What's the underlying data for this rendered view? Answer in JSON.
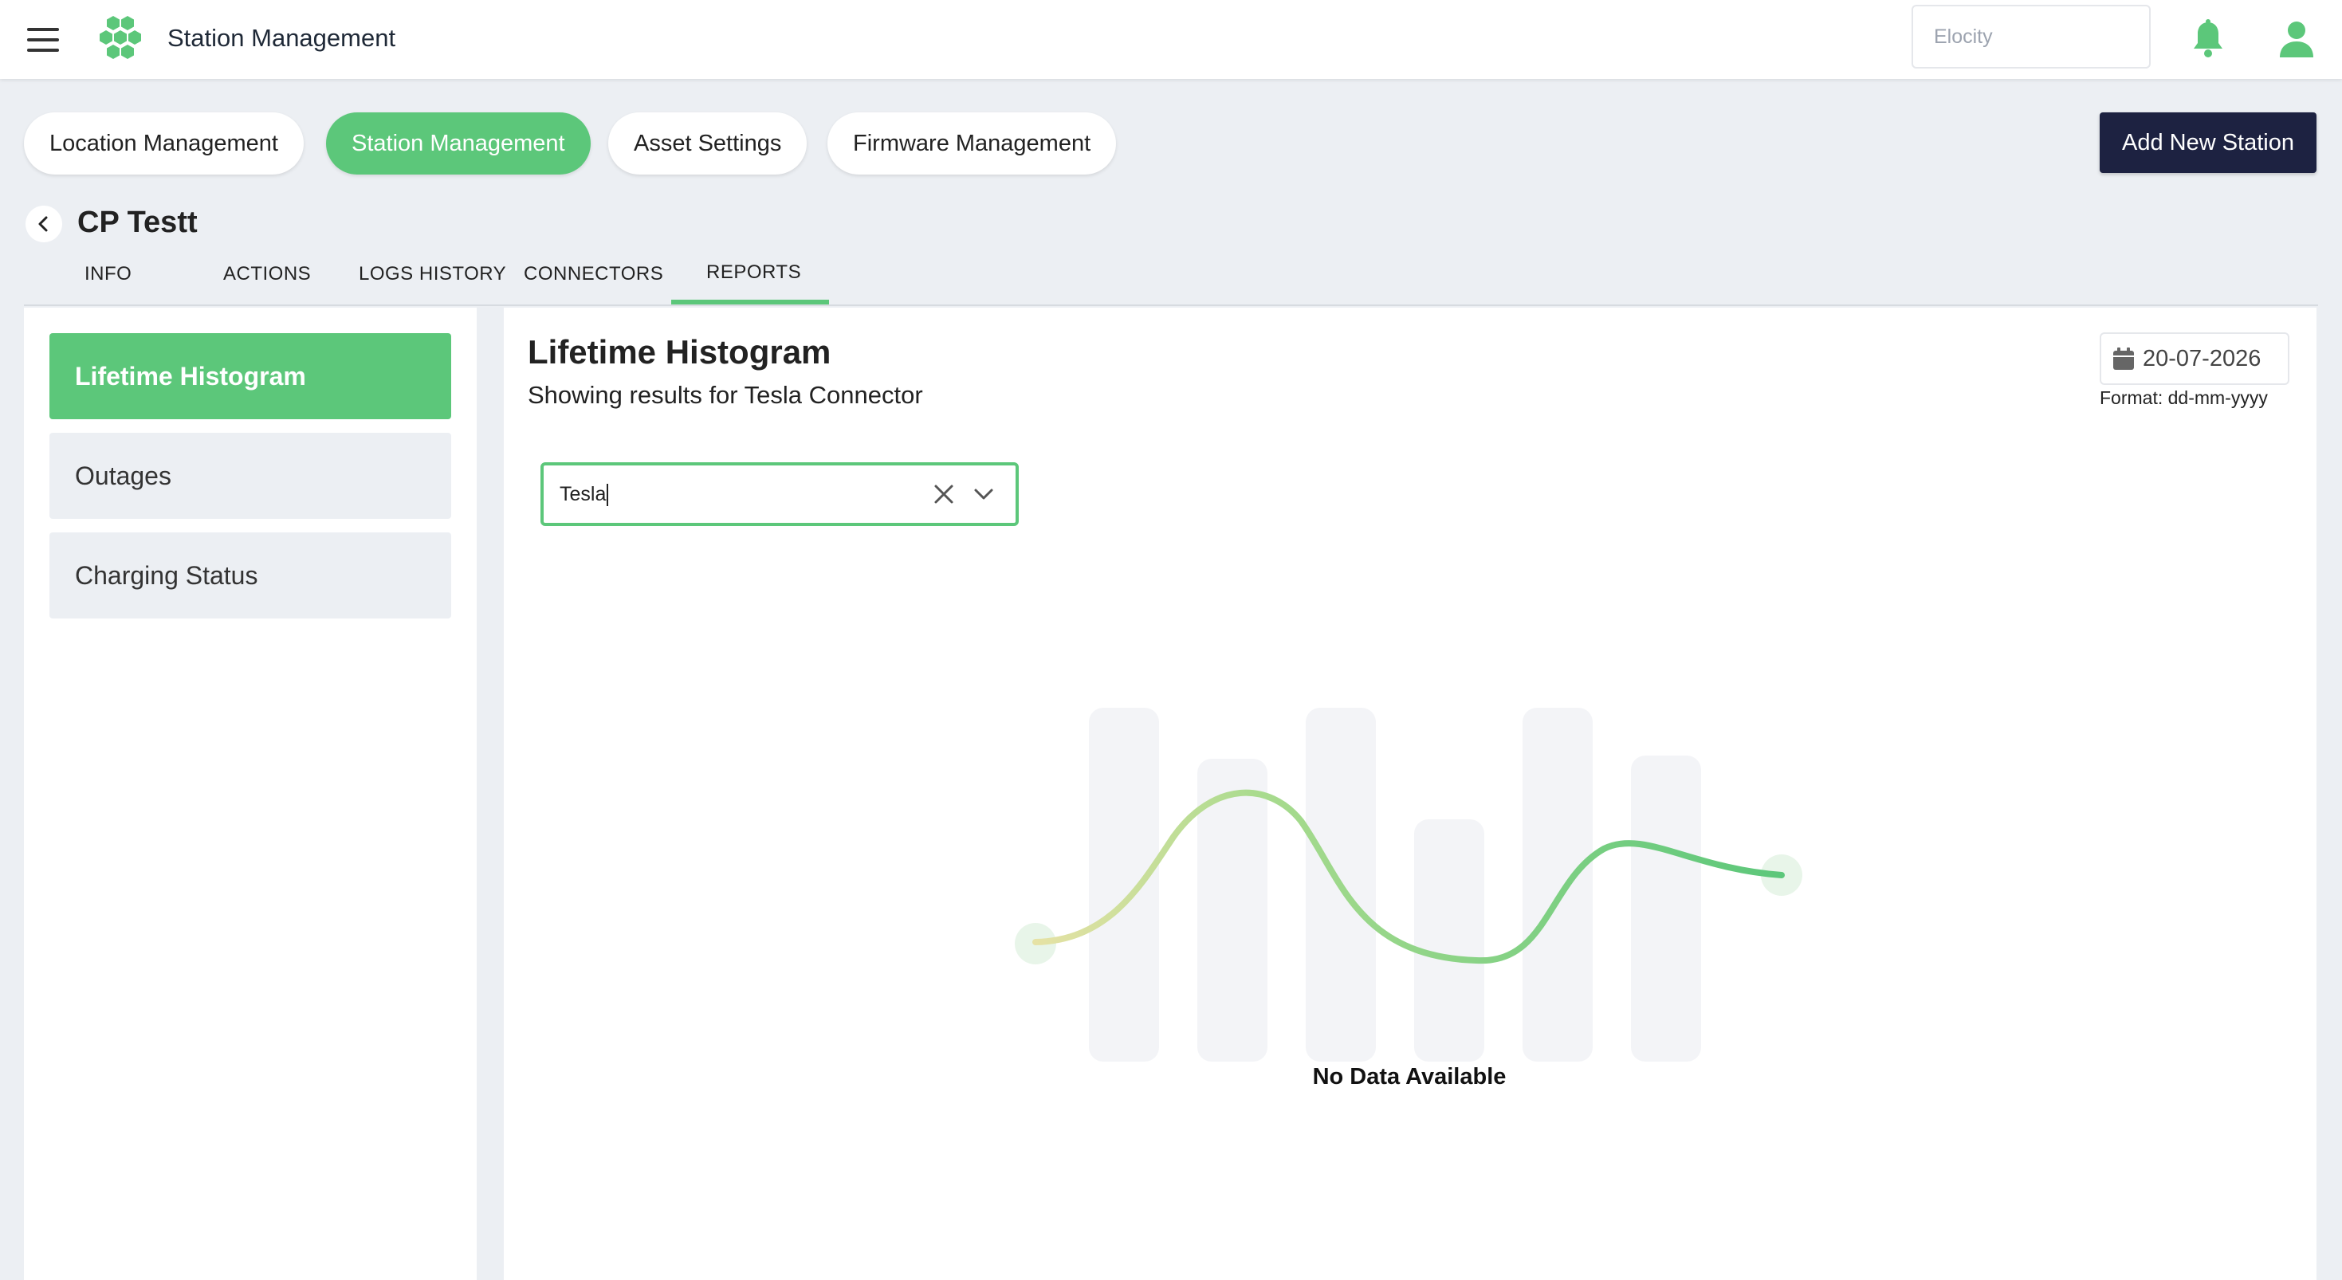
{
  "header": {
    "app_title": "Station Management",
    "org_select": {
      "value": "Elocity"
    },
    "icons": [
      "menu-icon",
      "logo-icon",
      "bell-icon",
      "user-icon"
    ],
    "accent_color": "#5cc77a"
  },
  "top_tabs": [
    {
      "label": "Location Management",
      "active": false
    },
    {
      "label": "Station Management",
      "active": true
    },
    {
      "label": "Asset Settings",
      "active": false
    },
    {
      "label": "Firmware Management",
      "active": false
    }
  ],
  "add_button": {
    "label": "Add New Station",
    "color": "#1d2241"
  },
  "station": {
    "title": "CP Testt",
    "tabs": [
      {
        "label": "INFO",
        "active": false
      },
      {
        "label": "ACTIONS",
        "active": false
      },
      {
        "label": "LOGS HISTORY",
        "active": false
      },
      {
        "label": "CONNECTORS",
        "active": false
      },
      {
        "label": "REPORTS",
        "active": true
      }
    ]
  },
  "sidebar": {
    "items": [
      {
        "label": "Lifetime Histogram",
        "active": true
      },
      {
        "label": "Outages",
        "active": false
      },
      {
        "label": "Charging Status",
        "active": false
      }
    ]
  },
  "report": {
    "title": "Lifetime Histogram",
    "subtitle": "Showing results for Tesla Connector",
    "date": {
      "value": "20-07-2026",
      "format_hint": "Format: dd-mm-yyyy"
    },
    "connector_select": {
      "value": "Tesla"
    },
    "empty_state": "No Data Available"
  }
}
